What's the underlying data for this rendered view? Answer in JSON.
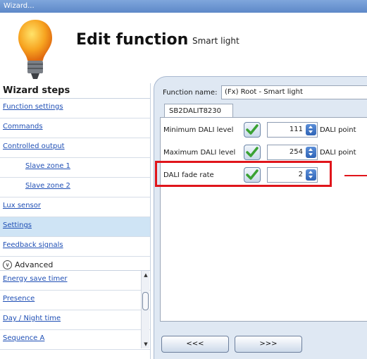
{
  "window": {
    "title": "Wizard..."
  },
  "header": {
    "title": "Edit function",
    "subtitle": "Smart light",
    "icon": "lightbulb-icon"
  },
  "sidebar": {
    "heading": "Wizard steps",
    "items": [
      {
        "label": "Function settings"
      },
      {
        "label": "Commands"
      },
      {
        "label": "Controlled output"
      },
      {
        "label": "Slave zone 1"
      },
      {
        "label": "Slave zone 2"
      },
      {
        "label": "Lux sensor"
      },
      {
        "label": "Settings"
      },
      {
        "label": "Feedback signals"
      }
    ],
    "advanced_label": "Advanced",
    "advanced_items": [
      {
        "label": "Energy save timer"
      },
      {
        "label": "Presence"
      },
      {
        "label": "Day / Night time"
      },
      {
        "label": "Sequence A"
      }
    ]
  },
  "main": {
    "function_name_label": "Function name:",
    "function_name_value": "(Fx) Root - Smart light",
    "tab_label": "SB2DALIT8230",
    "rows": [
      {
        "label": "Minimum DALI level",
        "value": "111",
        "unit": "DALI point"
      },
      {
        "label": "Maximum DALI level",
        "value": "254",
        "unit": "DALI point"
      },
      {
        "label": "DALI fade rate",
        "value": "2",
        "unit": ""
      }
    ]
  },
  "nav": {
    "back_label": "<<<",
    "next_label": ">>>"
  },
  "colors": {
    "highlight": "#e0151b",
    "active_step": "#cfe4f5",
    "link": "#1f4fb5"
  }
}
